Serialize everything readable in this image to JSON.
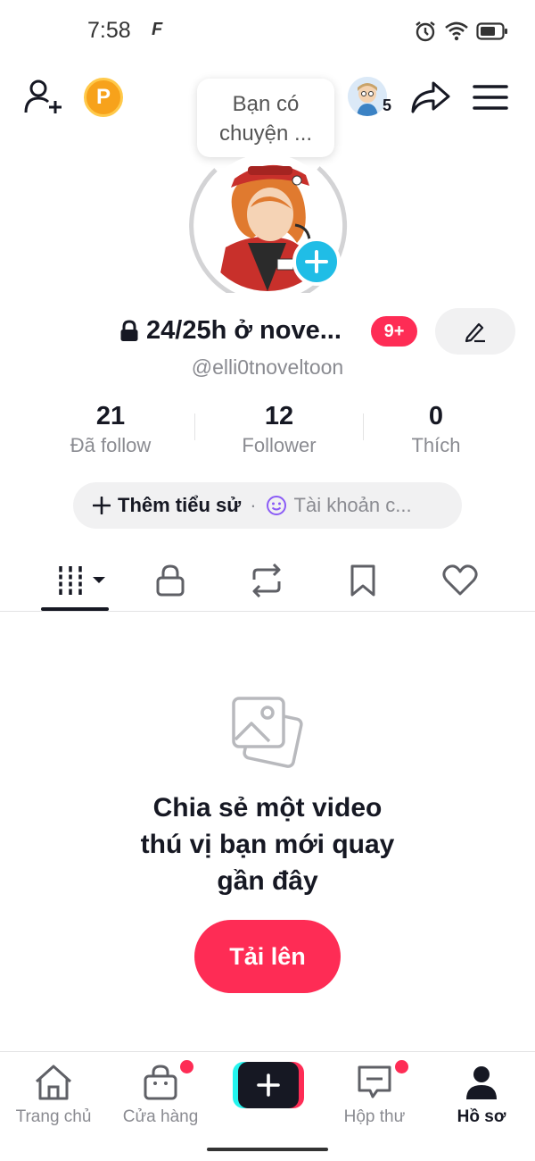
{
  "status_bar": {
    "time": "7:58",
    "carrier_glyph": "F",
    "icons": [
      "alarm-icon",
      "wifi-icon",
      "battery-icon"
    ]
  },
  "header": {
    "tooltip_line1": "Bạn có",
    "tooltip_line2": "chuyện ...",
    "coin_letter": "P",
    "friends_count": "5"
  },
  "profile": {
    "name": "24/25h ở nove...",
    "notification_badge": "9+",
    "username": "@elli0tnoveltoon"
  },
  "stats": [
    {
      "value": "21",
      "label": "Đã follow"
    },
    {
      "value": "12",
      "label": "Follower"
    },
    {
      "value": "0",
      "label": "Thích"
    }
  ],
  "bio": {
    "add_label": "Thêm tiểu sử",
    "separator": "·",
    "account_label": "Tài khoản c..."
  },
  "tabs": [
    "videos-tab",
    "private-tab",
    "reposts-tab",
    "favorites-tab",
    "liked-tab"
  ],
  "empty_state": {
    "line1": "Chia sẻ một video",
    "line2": "thú vị bạn mới quay",
    "line3": "gần đây",
    "upload_label": "Tải lên"
  },
  "bottom_nav": [
    {
      "label": "Trang chủ",
      "active": false
    },
    {
      "label": "Cửa hàng",
      "active": false,
      "badge": true
    },
    {
      "label": "",
      "active": false
    },
    {
      "label": "Hộp thư",
      "active": false,
      "badge": true
    },
    {
      "label": "Hồ sơ",
      "active": true
    }
  ],
  "colors": {
    "accent": "#fe2c55",
    "cyan": "#25f4ee",
    "add_blue": "#20bde6",
    "coin": "#f7a21b",
    "text": "#161823",
    "muted": "#8a8b91"
  }
}
